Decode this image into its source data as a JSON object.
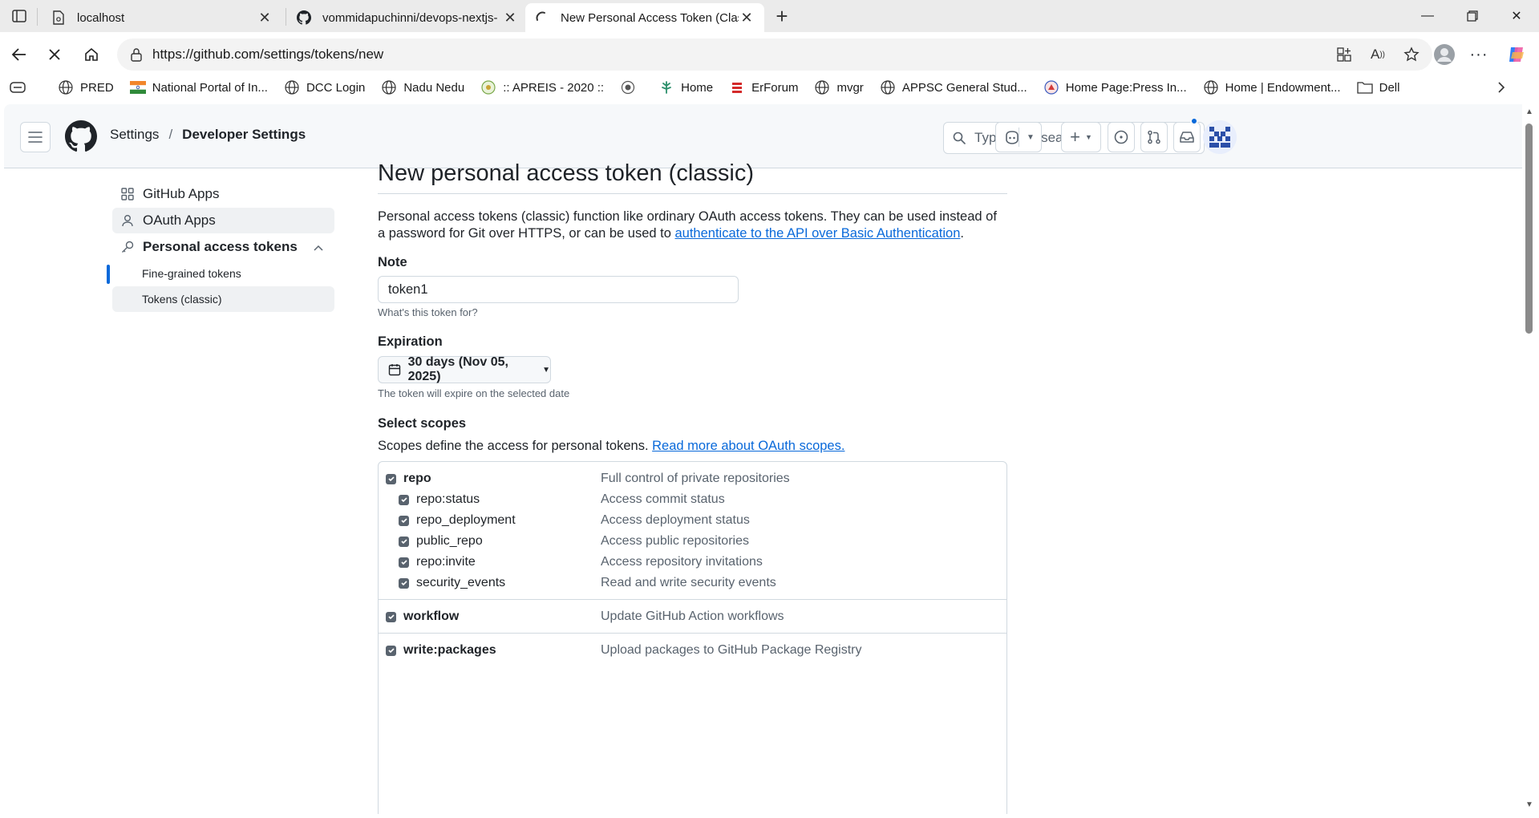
{
  "browser": {
    "tabs": [
      {
        "title": "localhost",
        "icon": "doc-icon",
        "active": false
      },
      {
        "title": "vommidapuchinni/devops-nextjs-",
        "icon": "github-icon",
        "active": false
      },
      {
        "title": "New Personal Access Token (Class",
        "icon": "loading-icon",
        "active": true
      }
    ],
    "url": "https://github.com/settings/tokens/new",
    "bookmarks": [
      {
        "label": "",
        "icon": "reading-list-icon"
      },
      {
        "label": "PRED",
        "icon": "globe-icon"
      },
      {
        "label": "National Portal of In...",
        "icon": "india-flag-icon"
      },
      {
        "label": "DCC Login",
        "icon": "globe-icon"
      },
      {
        "label": "Nadu Nedu",
        "icon": "globe-icon"
      },
      {
        "label": ":: APREIS - 2020 ::",
        "icon": "emblem-icon"
      },
      {
        "label": "",
        "icon": "seal-icon"
      },
      {
        "label": "Home",
        "icon": "tree-icon"
      },
      {
        "label": "ErForum",
        "icon": "bars-icon"
      },
      {
        "label": "mvgr",
        "icon": "globe-icon"
      },
      {
        "label": "APPSC General Stud...",
        "icon": "globe-icon"
      },
      {
        "label": "Home Page:Press In...",
        "icon": "press-icon"
      },
      {
        "label": "Home | Endowment...",
        "icon": "globe-icon"
      },
      {
        "label": "Dell",
        "icon": "folder-icon"
      }
    ]
  },
  "header": {
    "crumb_settings": "Settings",
    "crumb_sep": "/",
    "crumb_developer": "Developer Settings",
    "search_prefix": "Type",
    "search_key": "/",
    "search_suffix": "to search"
  },
  "sidebar": {
    "items": [
      {
        "label": "GitHub Apps",
        "icon": "apps-icon"
      },
      {
        "label": "OAuth Apps",
        "icon": "person-icon"
      },
      {
        "label": "Personal access tokens",
        "icon": "key-icon"
      }
    ],
    "subitems": [
      {
        "label": "Fine-grained tokens"
      },
      {
        "label": "Tokens (classic)"
      }
    ]
  },
  "main": {
    "title": "New personal access token (classic)",
    "intro_text": "Personal access tokens (classic) function like ordinary OAuth access tokens. They can be used instead of a password for Git over HTTPS, or can be used to ",
    "intro_link": "authenticate to the API over Basic Authentication",
    "intro_end": ".",
    "note_label": "Note",
    "note_value": "token1",
    "note_hint": "What's this token for?",
    "expiration_label": "Expiration",
    "expiration_value": "30 days (Nov 05, 2025)",
    "expiration_hint": "The token will expire on the selected date",
    "scopes_label": "Select scopes",
    "scopes_text": "Scopes define the access for personal tokens. ",
    "scopes_link": "Read more about OAuth scopes.",
    "scopes": [
      {
        "name": "repo",
        "desc": "Full control of private repositories",
        "checked": true
      },
      {
        "name": "repo:status",
        "desc": "Access commit status",
        "checked": true
      },
      {
        "name": "repo_deployment",
        "desc": "Access deployment status",
        "checked": true
      },
      {
        "name": "public_repo",
        "desc": "Access public repositories",
        "checked": true
      },
      {
        "name": "repo:invite",
        "desc": "Access repository invitations",
        "checked": true
      },
      {
        "name": "security_events",
        "desc": "Read and write security events",
        "checked": true
      },
      {
        "name": "workflow",
        "desc": "Update GitHub Action workflows",
        "checked": true
      },
      {
        "name": "write:packages",
        "desc": "Upload packages to GitHub Package Registry",
        "checked": true
      }
    ]
  },
  "colors": {
    "accent": "#0969da",
    "text": "#1f2328",
    "muted": "#59636e",
    "border": "#d1d9e0"
  }
}
